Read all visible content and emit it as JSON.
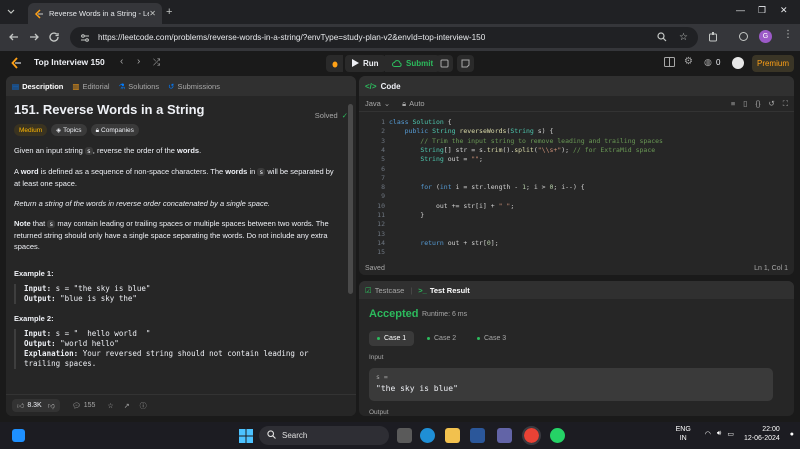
{
  "browser": {
    "tab_title": "Reverse Words in a String - Lee",
    "url": "https://leetcode.com/problems/reverse-words-in-a-string/?envType=study-plan-v2&envId=top-interview-150",
    "profile_initial": "G"
  },
  "header": {
    "list_name": "Top Interview 150",
    "run_label": "Run",
    "submit_label": "Submit",
    "notif_count": "0",
    "premium_label": "Premium"
  },
  "left_tabs": [
    "Description",
    "Editorial",
    "Solutions",
    "Submissions"
  ],
  "problem": {
    "title": "151. Reverse Words in a String",
    "status": "Solved",
    "difficulty": "Medium",
    "topics_label": "Topics",
    "companies_label": "Companies",
    "p1_a": "Given an input string ",
    "p1_code": "s",
    "p1_b": ", reverse the order of the ",
    "p1_bold": "words",
    "p1_c": ".",
    "p2_a": "A ",
    "p2_bold1": "word",
    "p2_b": " is defined as a sequence of non-space characters. The ",
    "p2_bold2": "words",
    "p2_c": " in ",
    "p2_code": "s",
    "p2_d": " will be separated by at least one space.",
    "p3": "Return a string of the words in reverse order concatenated by a single space.",
    "p4_bold": "Note",
    "p4_a": " that ",
    "p4_code": "s",
    "p4_b": " may contain leading or trailing spaces or multiple spaces between two words. The returned string should only have a single space separating the words. Do not include any extra spaces.",
    "ex1_title": "Example 1:",
    "ex1_input_label": "Input:",
    "ex1_input": " s = \"the sky is blue\"",
    "ex1_output_label": "Output:",
    "ex1_output": " \"blue is sky the\"",
    "ex2_title": "Example 2:",
    "ex2_input_label": "Input:",
    "ex2_input": " s = \"  hello world  \"",
    "ex2_output_label": "Output:",
    "ex2_output": " \"world hello\"",
    "ex2_expl_label": "Explanation:",
    "ex2_expl": " Your reversed string should not contain leading or trailing spaces."
  },
  "left_footer": {
    "likes": "8.3K",
    "comments": "155"
  },
  "code_panel": {
    "title": "Code",
    "language": "Java",
    "mode": "Auto",
    "status": "Saved",
    "cursor": "Ln 1, Col 1"
  },
  "code_lines": [
    {
      "n": "1",
      "parts": [
        [
          "kw",
          "class "
        ],
        [
          "ty",
          "Solution "
        ],
        [
          "pl",
          "{"
        ]
      ]
    },
    {
      "n": "2",
      "parts": [
        [
          "pl",
          "    "
        ],
        [
          "kw",
          "public "
        ],
        [
          "ty",
          "String "
        ],
        [
          "fn",
          "reverseWords"
        ],
        [
          "pl",
          "("
        ],
        [
          "ty",
          "String "
        ],
        [
          "pl",
          "s) {"
        ]
      ]
    },
    {
      "n": "3",
      "parts": [
        [
          "cm",
          "        // Trim the input string to remove leading and trailing spaces"
        ]
      ]
    },
    {
      "n": "4",
      "parts": [
        [
          "pl",
          "        "
        ],
        [
          "ty",
          "String"
        ],
        [
          "pl",
          "[] str = s."
        ],
        [
          "fn",
          "trim"
        ],
        [
          "pl",
          "()."
        ],
        [
          "fn",
          "split"
        ],
        [
          "pl",
          "("
        ],
        [
          "st",
          "\"\\\\s+\""
        ],
        [
          "pl",
          "); "
        ],
        [
          "cm",
          "// for ExtraMid space"
        ]
      ]
    },
    {
      "n": "5",
      "parts": [
        [
          "pl",
          "        "
        ],
        [
          "ty",
          "String "
        ],
        [
          "pl",
          "out = "
        ],
        [
          "st",
          "\"\""
        ],
        [
          "pl",
          ";"
        ]
      ]
    },
    {
      "n": "6",
      "parts": []
    },
    {
      "n": "7",
      "parts": []
    },
    {
      "n": "8",
      "parts": [
        [
          "pl",
          "        "
        ],
        [
          "kw",
          "for "
        ],
        [
          "pl",
          "("
        ],
        [
          "kw",
          "int "
        ],
        [
          "pl",
          "i = str.length - "
        ],
        [
          "nm",
          "1"
        ],
        [
          "pl",
          "; i > "
        ],
        [
          "nm",
          "0"
        ],
        [
          "pl",
          "; i--) {"
        ]
      ]
    },
    {
      "n": "9",
      "parts": []
    },
    {
      "n": "10",
      "parts": [
        [
          "pl",
          "            out += str[i] + "
        ],
        [
          "st",
          "\" \""
        ],
        [
          "pl",
          ";"
        ]
      ]
    },
    {
      "n": "11",
      "parts": [
        [
          "pl",
          "        }"
        ]
      ]
    },
    {
      "n": "12",
      "parts": []
    },
    {
      "n": "13",
      "parts": []
    },
    {
      "n": "14",
      "parts": [
        [
          "pl",
          "        "
        ],
        [
          "kw",
          "return "
        ],
        [
          "pl",
          "out + str["
        ],
        [
          "nm",
          "0"
        ],
        [
          "pl",
          "];"
        ]
      ]
    },
    {
      "n": "15",
      "parts": []
    }
  ],
  "result_panel": {
    "testcase_label": "Testcase",
    "result_label": "Test Result",
    "verdict": "Accepted",
    "runtime": "Runtime: 6 ms",
    "cases": [
      "Case 1",
      "Case 2",
      "Case 3"
    ],
    "input_label": "Input",
    "var_name": "s =",
    "var_value": "\"the sky is blue\"",
    "output_label": "Output"
  },
  "taskbar": {
    "search_label": "Search",
    "lang": "ENG",
    "region": "IN",
    "time": "22:00",
    "date": "12-06-2024"
  },
  "colors": {
    "accepted": "#2cbb5d",
    "medium": "#ffb800",
    "premium": "#ffa116"
  }
}
